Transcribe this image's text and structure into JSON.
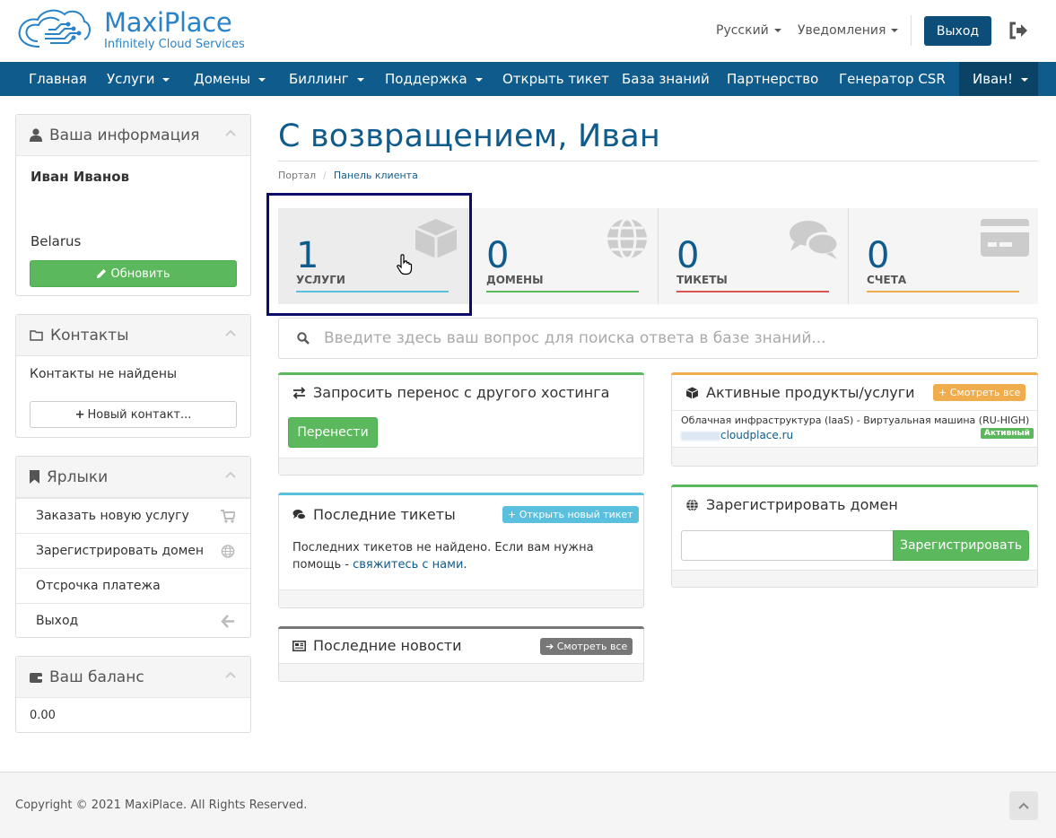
{
  "brand": {
    "name": "MaxiPlace",
    "tagline": "Infinitely Cloud Services",
    "accent": "#2a83c6"
  },
  "header": {
    "language": "Русский",
    "notifications": "Уведомления",
    "logout_label": "Выход"
  },
  "nav": {
    "items": [
      {
        "label": "Главная",
        "dropdown": false
      },
      {
        "label": "Услуги",
        "dropdown": true
      },
      {
        "label": "Домены",
        "dropdown": true
      },
      {
        "label": "Биллинг",
        "dropdown": true
      },
      {
        "label": "Поддержка",
        "dropdown": true
      },
      {
        "label": "Открыть тикет",
        "dropdown": false
      },
      {
        "label": "База знаний",
        "dropdown": false
      },
      {
        "label": "Партнерство",
        "dropdown": false
      },
      {
        "label": "Генератор CSR",
        "dropdown": false
      }
    ],
    "user": "Иван!",
    "color": "#0f5b8c"
  },
  "sidebar": {
    "info": {
      "title": "Ваша информация",
      "name": "Иван Иванов",
      "country": "Belarus",
      "update_label": "Обновить"
    },
    "contacts": {
      "title": "Контакты",
      "empty": "Контакты не найдены",
      "new_label": "Новый контакт..."
    },
    "shortcuts": {
      "title": "Ярлыки",
      "items": [
        {
          "label": "Заказать новую услугу",
          "icon": "cart-icon"
        },
        {
          "label": "Зарегистрировать домен",
          "icon": "globe-icon"
        },
        {
          "label": "Отсрочка платежа",
          "icon": ""
        },
        {
          "label": "Выход",
          "icon": "arrow-left-icon"
        }
      ]
    },
    "balance": {
      "title": "Ваш баланс",
      "value": "0.00"
    }
  },
  "main": {
    "title": "С возвращением, Иван",
    "breadcrumb": [
      "Портал",
      "Панель клиента"
    ],
    "tiles": [
      {
        "count": "1",
        "label": "УСЛУГИ",
        "color": "#5bc0de",
        "icon": "cube-icon"
      },
      {
        "count": "0",
        "label": "ДОМЕНЫ",
        "color": "#5cb85c",
        "icon": "globe-icon"
      },
      {
        "count": "0",
        "label": "ТИКЕТЫ",
        "color": "#d9534f",
        "icon": "comments-icon"
      },
      {
        "count": "0",
        "label": "СЧЕТА",
        "color": "#f0ad4e",
        "icon": "credit-card-icon"
      }
    ],
    "search_placeholder": "Введите здесь ваш вопрос для поиска ответа в базе знаний..."
  },
  "cards": {
    "transfer": {
      "title": "Запросить перенос с другого хостинга",
      "button": "Перенести"
    },
    "tickets": {
      "title": "Последние тикеты",
      "button": "Открыть новый тикет",
      "text": "Последних тикетов не найдено. Если вам нужна помощь -",
      "link": "свяжитесь с нами",
      "tail": "."
    },
    "news": {
      "title": "Последние новости",
      "button": "Смотреть все"
    },
    "products": {
      "title": "Активные продукты/услуги",
      "button": "Смотреть все",
      "item_name": "Облачная инфраструктура (IaaS) - Виртуальная машина (RU-HIGH)",
      "item_domain": "cloudplace.ru",
      "status": "Активный"
    },
    "register": {
      "title": "Зарегистрировать домен",
      "button": "Зарегистрировать",
      "input_value": ""
    }
  },
  "footer": {
    "copyright": "Copyright © 2021 MaxiPlace. All Rights Reserved."
  }
}
